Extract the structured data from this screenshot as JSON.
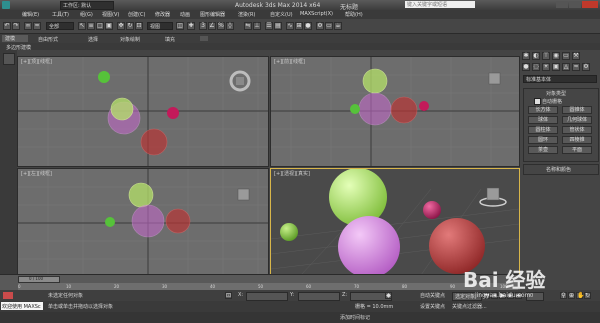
{
  "app": {
    "title": "Autodesk 3ds Max  2014 x64",
    "doc_title": "无标题",
    "workspace": "工作区: 默认",
    "search_placeholder": "键入关键字或短语"
  },
  "menu": [
    "编辑(E)",
    "工具(T)",
    "组(G)",
    "视图(V)",
    "创建(C)",
    "修改器",
    "动画",
    "图形编辑器",
    "渲染(R)",
    "自定义(U)",
    "MAXScript(X)",
    "帮助(H)"
  ],
  "toolbar": {
    "selection_filter": "全部",
    "ref_coord": "视图"
  },
  "ribbon": {
    "tabs": [
      "建模",
      "自由形式",
      "选择",
      "对象绘制",
      "填充"
    ],
    "subtitle": "多边形建模"
  },
  "viewports": {
    "top": "[+][顶][线框]",
    "front": "[+][前][线框]",
    "left": "[+][左][线框]",
    "persp": "[+][透视][真实]"
  },
  "right_panel": {
    "dropdown": "标准基本体",
    "section_object_type": "对象类型",
    "autogrid": "自动栅格",
    "buttons": [
      "长方体",
      "圆锥体",
      "球体",
      "几何球体",
      "圆柱体",
      "管状体",
      "圆环",
      "四棱锥",
      "茶壶",
      "平面"
    ],
    "section_name_color": "名称和颜色"
  },
  "timeline": {
    "frame": "0 / 100",
    "ticks": [
      "0",
      "10",
      "20",
      "30",
      "40",
      "50",
      "60",
      "70",
      "80",
      "90",
      "100"
    ]
  },
  "status": {
    "selection": "未选定任何对象",
    "prompt": "单击或单击并拖动以选择对象",
    "welcome": "欢迎使用 MAXSc",
    "grid": "栅格 = 10.0mm",
    "autokey": "自动关键点",
    "setkey": "设置关键点",
    "selected": "选定对象",
    "key_filters": "关键点过滤器...",
    "add_time_tag": "添加时间标记",
    "x_label": "X:",
    "y_label": "Y:",
    "z_label": "Z:",
    "frame_field": "0"
  },
  "watermark": "Bai 经验",
  "watermark_url": "jingyan.baidu.com"
}
